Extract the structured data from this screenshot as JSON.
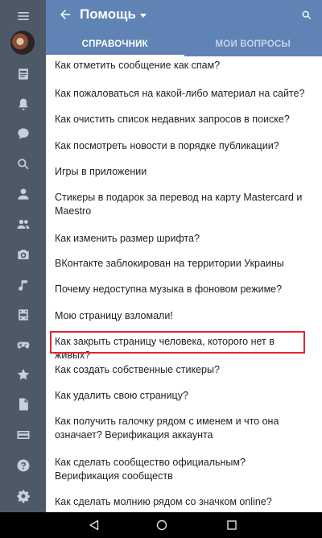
{
  "header": {
    "title": "Помощь",
    "tabs": [
      {
        "label": "СПРАВОЧНИК",
        "active": true
      },
      {
        "label": "МОИ ВОПРОСЫ",
        "active": false
      }
    ]
  },
  "rail": {
    "items": [
      "menu-icon",
      "avatar",
      "news-icon",
      "notifications-icon",
      "messages-icon",
      "search-icon",
      "friends-icon",
      "groups-icon",
      "photos-icon",
      "music-icon",
      "videos-icon",
      "games-icon",
      "favorites-icon",
      "documents-icon",
      "payments-icon",
      "help-icon",
      "settings-icon"
    ]
  },
  "help_items": [
    "Как отметить сообщение как спам?",
    "Как пожаловаться на какой-либо материал на сайте?",
    "Как очистить список недавних запросов в поиске?",
    "Как посмотреть новости в порядке публикации?",
    "Игры в приложении",
    "Стикеры в подарок за перевод на карту Mastercard и Maestro",
    "Как изменить размер шрифта?",
    "ВКонтакте заблокирован на территории Украины",
    "Почему недоступна музыка в фоновом режиме?",
    "Мою страницу взломали!",
    "Как закрыть страницу человека, которого нет в живых?",
    "Как создать собственные стикеры?",
    "Как удалить свою страницу?",
    "Как получить галочку рядом с именем и что она означает? Верификация аккаунта",
    "Как сделать сообщество официальным? Верификация сообществ",
    "Как сделать молнию рядом со значком online?"
  ],
  "highlighted_item_index": 10,
  "colors": {
    "header_bg": "#5f83b4",
    "rail_bg": "#4e5967",
    "highlight_border": "#e0262c"
  }
}
